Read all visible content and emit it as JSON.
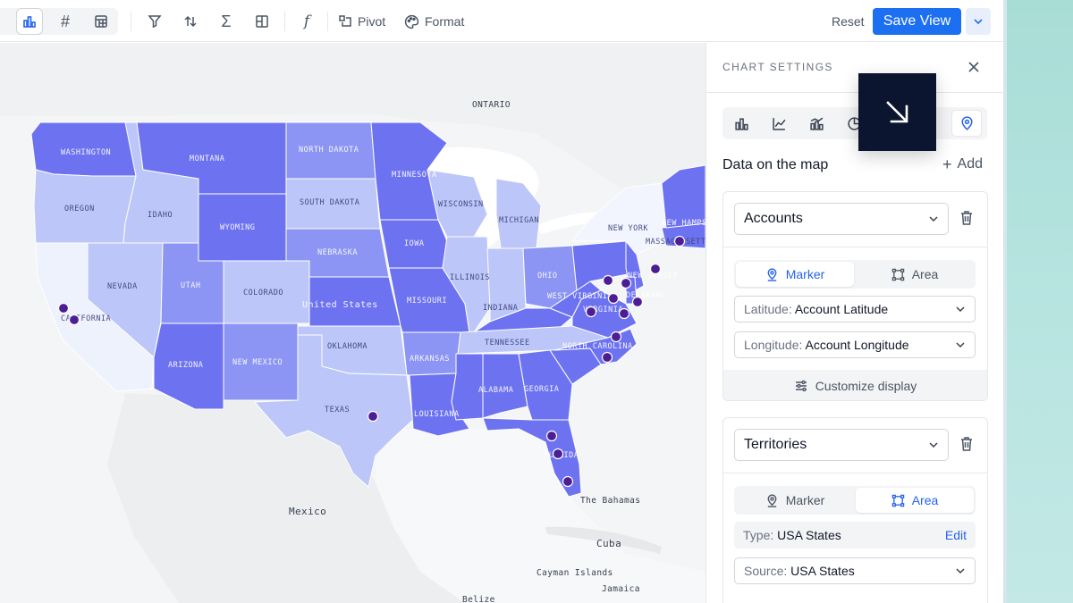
{
  "toolbar": {
    "pivot_label": "Pivot",
    "format_label": "Format",
    "reset_label": "Reset",
    "save_label": "Save View"
  },
  "map": {
    "geo_labels": {
      "ontario": "ONTARIO",
      "mexico": "Mexico",
      "bahamas": "The Bahamas",
      "cuba": "Cuba",
      "cayman": "Cayman Islands",
      "jamaica": "Jamaica",
      "belize": "Belize"
    },
    "states": {
      "washington": "WASHINGTON",
      "oregon": "OREGON",
      "california": "CALIFORNIA",
      "nevada": "NEVADA",
      "idaho": "IDAHO",
      "montana": "MONTANA",
      "wyoming": "WYOMING",
      "utah": "UTAH",
      "colorado": "COLORADO",
      "arizona": "ARIZONA",
      "new_mexico": "NEW MEXICO",
      "north_dakota": "NORTH DAKOTA",
      "south_dakota": "SOUTH DAKOTA",
      "nebraska": "NEBRASKA",
      "kansas_label": "United States",
      "oklahoma": "OKLAHOMA",
      "texas": "TEXAS",
      "minnesota": "MINNESOTA",
      "iowa": "IOWA",
      "missouri": "MISSOURI",
      "arkansas": "ARKANSAS",
      "louisiana": "LOUISIANA",
      "wisconsin": "WISCONSIN",
      "illinois": "ILLINOIS",
      "michigan": "MICHIGAN",
      "indiana": "INDIANA",
      "ohio": "OHIO",
      "tennessee": "TENNESSEE",
      "alabama": "ALABAMA",
      "georgia": "GEORGIA",
      "florida": "FLORIDA",
      "north_carolina": "NORTH CAROLINA",
      "virginia": "VIRGINIA",
      "west_virginia": "WEST VIRGINIA",
      "new_york": "NEW YORK",
      "new_jersey": "NEW JERSEY",
      "delaware": "DELAWARE",
      "massachusetts": "MASSACHUSETTS",
      "new_hampshire": "NEW HAMPSHIRE"
    }
  },
  "panel": {
    "title": "CHART SETTINGS",
    "section_title": "Data on the map",
    "add_label": "Add",
    "layers": [
      {
        "name": "Accounts",
        "marker_label": "Marker",
        "area_label": "Area",
        "mode": "Marker",
        "lat_label": "Latitude:",
        "lat_value": "Account Latitude",
        "lng_label": "Longitude:",
        "lng_value": "Account Longitude",
        "customize_label": "Customize display"
      },
      {
        "name": "Territories",
        "marker_label": "Marker",
        "area_label": "Area",
        "mode": "Area",
        "type_label": "Type:",
        "type_value": "USA States",
        "edit_label": "Edit",
        "source_label": "Source:",
        "source_value": "USA States"
      }
    ]
  },
  "colors": {
    "accent": "#1d6ff2",
    "marker": "#4c1d95",
    "shade_dark": "#6d73f0",
    "shade_mid": "#8c95f3",
    "shade_light": "#bcc6f8",
    "shade_pale": "#dfe6fc"
  }
}
